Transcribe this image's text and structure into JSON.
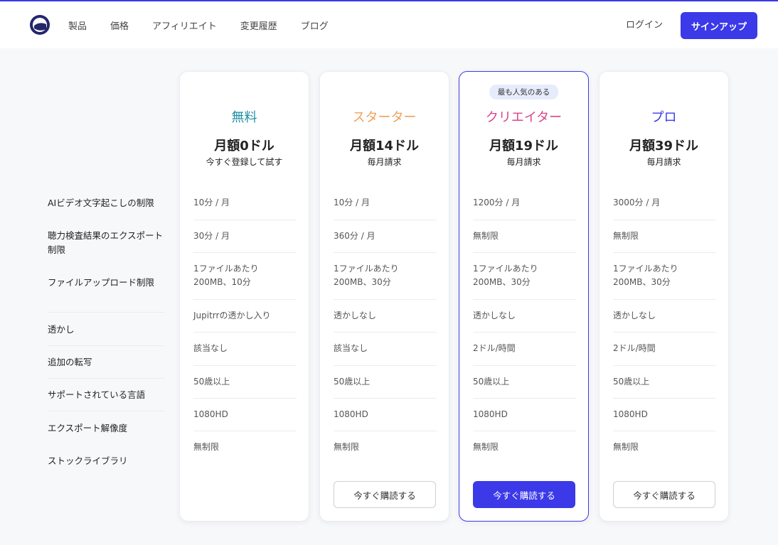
{
  "nav": {
    "items": [
      "製品",
      "価格",
      "アフィリエイト",
      "変更履歴",
      "ブログ"
    ],
    "login": "ログイン",
    "signup": "サインアップ"
  },
  "features": [
    "AIビデオ文字起こしの制限",
    "聴力検査結果のエクスポート制限",
    "ファイルアップロード制限",
    "透かし",
    "追加の転写",
    "サポートされている言語",
    "エクスポート解像度",
    "ストックライブラリ"
  ],
  "plans": [
    {
      "name": "無料",
      "color": "#1f8fa3",
      "price": "月額0ドル",
      "sub": "今すぐ登録して試す",
      "badge": "",
      "button": "",
      "cells": [
        "10分 / 月",
        "30分 / 月",
        "1ファイルあたり\n200MB、10分",
        "Jupitrrの透かし入り",
        "該当なし",
        "50歳以上",
        "1080HD",
        "無制限"
      ]
    },
    {
      "name": "スターター",
      "color": "#f0a05a",
      "price": "月額14ドル",
      "sub": "毎月請求",
      "badge": "",
      "button": "今すぐ購読する",
      "cells": [
        "10分 / 月",
        "360分 / 月",
        "1ファイルあたり\n200MB、30分",
        "透かしなし",
        "該当なし",
        "50歳以上",
        "1080HD",
        "無制限"
      ]
    },
    {
      "name": "クリエイター",
      "color": "#d9448a",
      "price": "月額19ドル",
      "sub": "毎月請求",
      "badge": "最も人気のある",
      "button": "今すぐ購読する",
      "cells": [
        "1200分 / 月",
        "無制限",
        "1ファイルあたり\n200MB、30分",
        "透かしなし",
        "2ドル/時間",
        "50歳以上",
        "1080HD",
        "無制限"
      ]
    },
    {
      "name": "プロ",
      "color": "#3b39e8",
      "price": "月額39ドル",
      "sub": "毎月請求",
      "badge": "",
      "button": "今すぐ購読する",
      "cells": [
        "3000分 / 月",
        "無制限",
        "1ファイルあたり\n200MB、30分",
        "透かしなし",
        "2ドル/時間",
        "50歳以上",
        "1080HD",
        "無制限"
      ]
    }
  ],
  "colors": {
    "accent": "#3b39e8"
  }
}
